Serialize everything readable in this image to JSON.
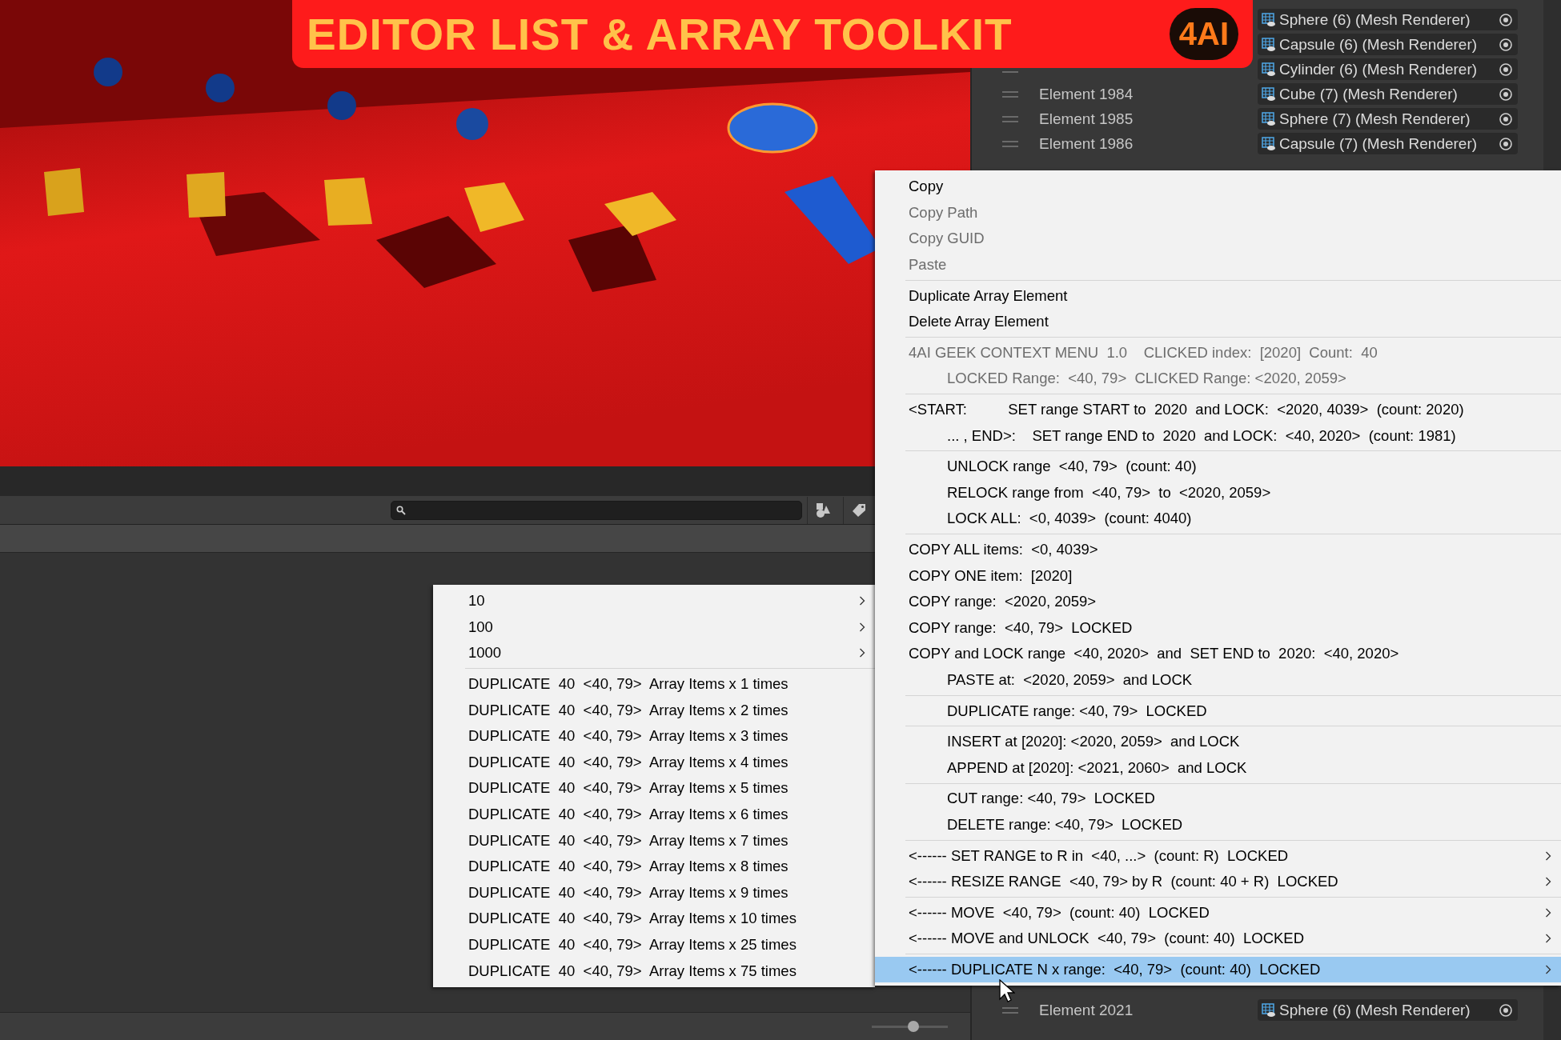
{
  "banner": {
    "title": "EDITOR LIST & ARRAY TOOLKIT",
    "logo": "4AI"
  },
  "zoom_slider": {
    "level": 0.55
  },
  "inspector": {
    "top_rows": [
      {
        "object": "Sphere (6) (Mesh Renderer)"
      },
      {
        "object": "Capsule (6) (Mesh Renderer)"
      },
      {
        "object": "Cylinder (6) (Mesh Renderer)"
      },
      {
        "label": "Element 1984",
        "object": "Cube (7) (Mesh Renderer)"
      },
      {
        "label": "Element 1985",
        "object": "Sphere (7) (Mesh Renderer)"
      },
      {
        "label": "Element 1986",
        "object": "Capsule (7) (Mesh Renderer)"
      }
    ],
    "bottom_rows": [
      {
        "label": "Element 2021",
        "object": "Sphere (6) (Mesh Renderer)"
      }
    ]
  },
  "submenu": {
    "groups": [
      [
        {
          "label": "10",
          "submenu": true
        },
        {
          "label": "100",
          "submenu": true
        },
        {
          "label": "1000",
          "submenu": true
        }
      ],
      [
        {
          "label": "DUPLICATE  40  <40, 79>  Array Items x 1 times",
          "submenu": false
        },
        {
          "label": "DUPLICATE  40  <40, 79>  Array Items x 2 times",
          "submenu": false
        },
        {
          "label": "DUPLICATE  40  <40, 79>  Array Items x 3 times",
          "submenu": false
        },
        {
          "label": "DUPLICATE  40  <40, 79>  Array Items x 4 times",
          "submenu": false
        },
        {
          "label": "DUPLICATE  40  <40, 79>  Array Items x 5 times",
          "submenu": false
        },
        {
          "label": "DUPLICATE  40  <40, 79>  Array Items x 6 times",
          "submenu": false
        },
        {
          "label": "DUPLICATE  40  <40, 79>  Array Items x 7 times",
          "submenu": false
        },
        {
          "label": "DUPLICATE  40  <40, 79>  Array Items x 8 times",
          "submenu": false
        },
        {
          "label": "DUPLICATE  40  <40, 79>  Array Items x 9 times",
          "submenu": false
        },
        {
          "label": "DUPLICATE  40  <40, 79>  Array Items x 10 times",
          "submenu": false
        },
        {
          "label": "DUPLICATE  40  <40, 79>  Array Items x 25 times",
          "submenu": false
        },
        {
          "label": "DUPLICATE  40  <40, 79>  Array Items x 75 times",
          "submenu": false
        }
      ]
    ]
  },
  "context_menu": {
    "groups": [
      [
        {
          "label": "Copy",
          "disabled": false,
          "indented": false,
          "submenu": false,
          "selected": false
        },
        {
          "label": "Copy Path",
          "disabled": true,
          "indented": false,
          "submenu": false,
          "selected": false
        },
        {
          "label": "Copy GUID",
          "disabled": true,
          "indented": false,
          "submenu": false,
          "selected": false
        },
        {
          "label": "Paste",
          "disabled": true,
          "indented": false,
          "submenu": false,
          "selected": false
        }
      ],
      [
        {
          "label": "Duplicate Array Element",
          "disabled": false,
          "indented": false,
          "submenu": false,
          "selected": false
        },
        {
          "label": "Delete Array Element",
          "disabled": false,
          "indented": false,
          "submenu": false,
          "selected": false
        }
      ],
      [
        {
          "label": "4AI GEEK CONTEXT MENU  1.0    CLICKED index:  [2020]  Count:  40",
          "disabled": true,
          "indented": false,
          "submenu": false,
          "selected": false
        },
        {
          "label": "LOCKED Range:  <40, 79>  CLICKED Range: <2020, 2059>",
          "disabled": true,
          "indented": true,
          "submenu": false,
          "selected": false
        }
      ],
      [
        {
          "label": "<START:          SET range START to  2020  and LOCK:  <2020, 4039>  (count: 2020)",
          "disabled": false,
          "indented": false,
          "submenu": false,
          "selected": false
        },
        {
          "label": "... , END>:    SET range END to  2020  and LOCK:  <40, 2020>  (count: 1981)",
          "disabled": false,
          "indented": true,
          "submenu": false,
          "selected": false
        }
      ],
      [
        {
          "label": "UNLOCK range  <40, 79>  (count: 40)",
          "disabled": false,
          "indented": true,
          "submenu": false,
          "selected": false
        },
        {
          "label": "RELOCK range from  <40, 79>  to  <2020, 2059>",
          "disabled": false,
          "indented": true,
          "submenu": false,
          "selected": false
        },
        {
          "label": "LOCK ALL:  <0, 4039>  (count: 4040)",
          "disabled": false,
          "indented": true,
          "submenu": false,
          "selected": false
        }
      ],
      [
        {
          "label": "COPY ALL items:  <0, 4039>",
          "disabled": false,
          "indented": false,
          "submenu": false,
          "selected": false
        },
        {
          "label": "COPY ONE item:  [2020]",
          "disabled": false,
          "indented": false,
          "submenu": false,
          "selected": false
        },
        {
          "label": "COPY range:  <2020, 2059>",
          "disabled": false,
          "indented": false,
          "submenu": false,
          "selected": false
        },
        {
          "label": "COPY range:  <40, 79>  LOCKED",
          "disabled": false,
          "indented": false,
          "submenu": false,
          "selected": false
        },
        {
          "label": "COPY and LOCK range  <40, 2020>  and  SET END to  2020:  <40, 2020>",
          "disabled": false,
          "indented": false,
          "submenu": false,
          "selected": false
        },
        {
          "label": "PASTE at:  <2020, 2059>  and LOCK",
          "disabled": false,
          "indented": true,
          "submenu": false,
          "selected": false
        }
      ],
      [
        {
          "label": "DUPLICATE range: <40, 79>  LOCKED",
          "disabled": false,
          "indented": true,
          "submenu": false,
          "selected": false
        }
      ],
      [
        {
          "label": "INSERT at [2020]: <2020, 2059>  and LOCK",
          "disabled": false,
          "indented": true,
          "submenu": false,
          "selected": false
        },
        {
          "label": "APPEND at [2020]: <2021, 2060>  and LOCK",
          "disabled": false,
          "indented": true,
          "submenu": false,
          "selected": false
        }
      ],
      [
        {
          "label": "CUT range: <40, 79>  LOCKED",
          "disabled": false,
          "indented": true,
          "submenu": false,
          "selected": false
        },
        {
          "label": "DELETE range: <40, 79>  LOCKED",
          "disabled": false,
          "indented": true,
          "submenu": false,
          "selected": false
        }
      ],
      [
        {
          "label": "<------ SET RANGE to R in  <40, ...>  (count: R)  LOCKED",
          "disabled": false,
          "indented": false,
          "submenu": true,
          "selected": false
        },
        {
          "label": "<------ RESIZE RANGE  <40, 79> by R  (count: 40 + R)  LOCKED",
          "disabled": false,
          "indented": false,
          "submenu": true,
          "selected": false
        }
      ],
      [
        {
          "label": "<------ MOVE  <40, 79>  (count: 40)  LOCKED",
          "disabled": false,
          "indented": false,
          "submenu": true,
          "selected": false
        },
        {
          "label": "<------ MOVE and UNLOCK  <40, 79>  (count: 40)  LOCKED",
          "disabled": false,
          "indented": false,
          "submenu": true,
          "selected": false
        }
      ],
      [
        {
          "label": "<------ DUPLICATE N x range:  <40, 79>  (count: 40)  LOCKED",
          "disabled": false,
          "indented": false,
          "submenu": true,
          "selected": true
        }
      ]
    ]
  }
}
